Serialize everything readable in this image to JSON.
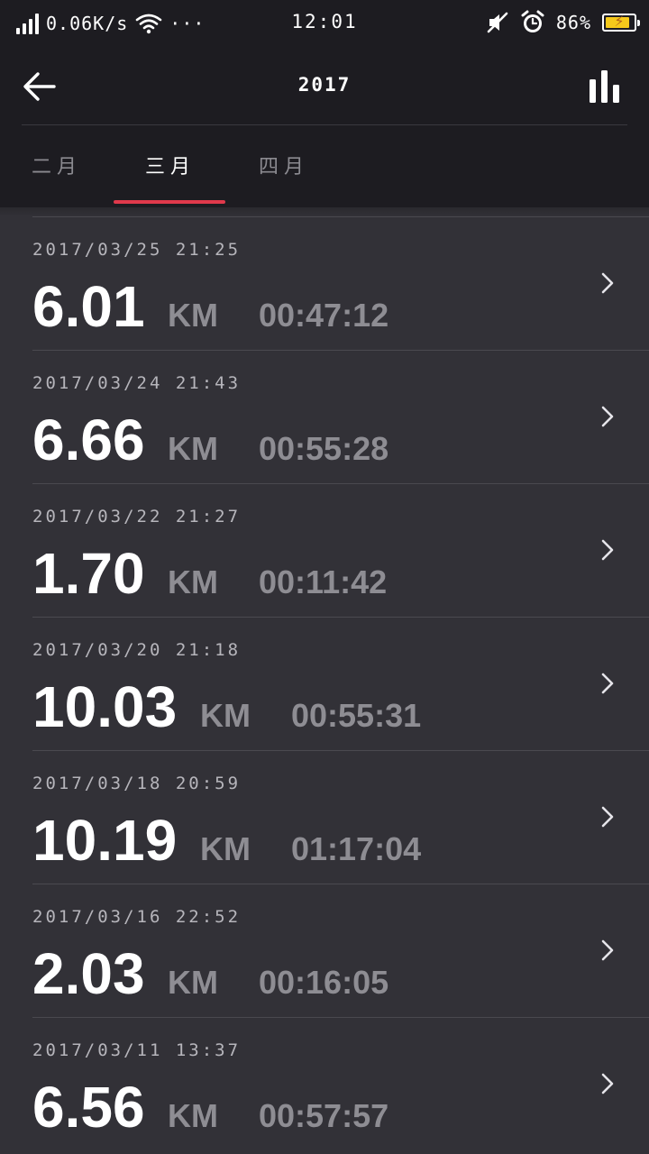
{
  "status_bar": {
    "network_speed": "0.06K/s",
    "more": "···",
    "time": "12:01",
    "battery": "86%",
    "battery_level": 0.86,
    "icons": [
      "signal-icon",
      "wifi-icon",
      "mute-icon",
      "alarm-icon",
      "battery-icon"
    ]
  },
  "header": {
    "title": "2017",
    "back_icon": "arrow-left-icon",
    "stats_icon": "bar-chart-icon"
  },
  "tabs": [
    {
      "label": "二月",
      "active": false
    },
    {
      "label": "三月",
      "active": true
    },
    {
      "label": "四月",
      "active": false
    }
  ],
  "colors": {
    "background": "#323137",
    "header_background": "#1d1c21",
    "accent": "#e0394b",
    "battery_fill": "#f6c91b"
  },
  "records": [
    {
      "date": "2017/03/25 21:25",
      "distance": "6.01",
      "unit": "KM",
      "duration": "00:47:12"
    },
    {
      "date": "2017/03/24 21:43",
      "distance": "6.66",
      "unit": "KM",
      "duration": "00:55:28"
    },
    {
      "date": "2017/03/22 21:27",
      "distance": "1.70",
      "unit": "KM",
      "duration": "00:11:42"
    },
    {
      "date": "2017/03/20 21:18",
      "distance": "10.03",
      "unit": "KM",
      "duration": "00:55:31"
    },
    {
      "date": "2017/03/18 20:59",
      "distance": "10.19",
      "unit": "KM",
      "duration": "01:17:04"
    },
    {
      "date": "2017/03/16 22:52",
      "distance": "2.03",
      "unit": "KM",
      "duration": "00:16:05"
    },
    {
      "date": "2017/03/11 13:37",
      "distance": "6.56",
      "unit": "KM",
      "duration": "00:57:57"
    }
  ]
}
